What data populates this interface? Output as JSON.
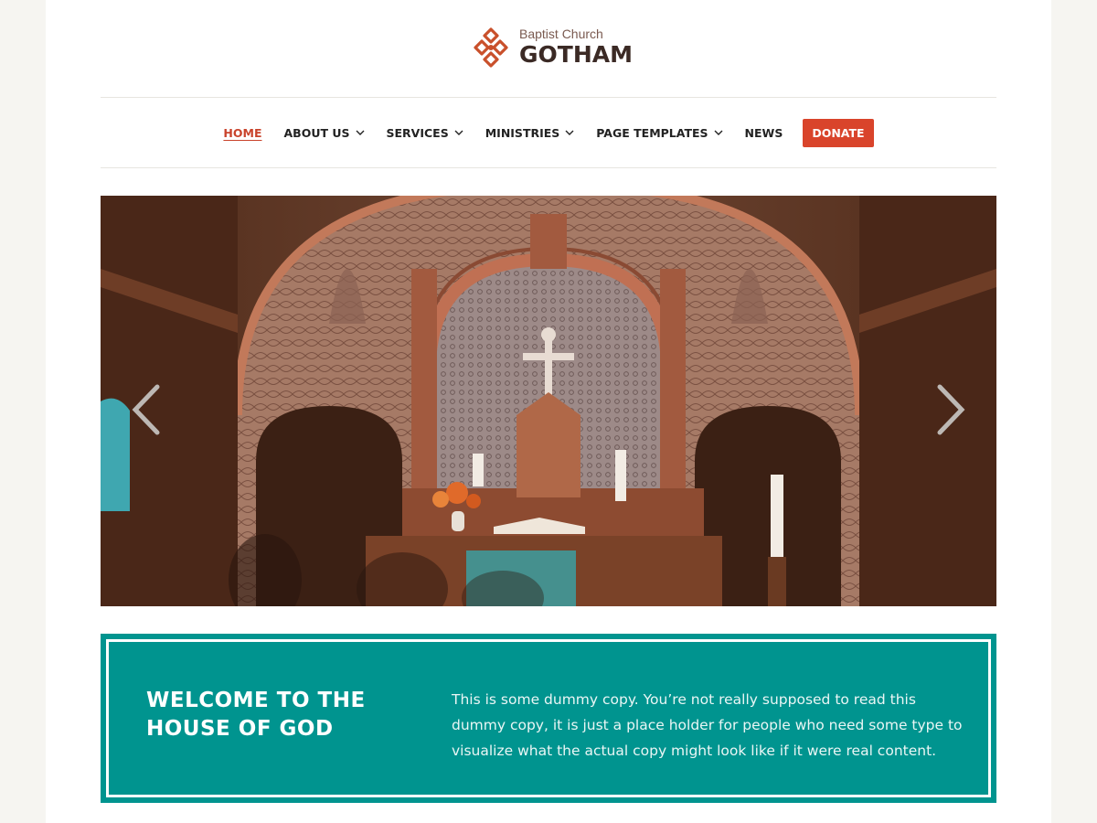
{
  "header": {
    "logo_subtitle": "Baptist Church",
    "logo_title": "GOTHAM"
  },
  "nav": {
    "items": [
      {
        "label": "HOME",
        "active": true,
        "has_dropdown": false
      },
      {
        "label": "ABOUT US",
        "active": false,
        "has_dropdown": true
      },
      {
        "label": "SERVICES",
        "active": false,
        "has_dropdown": true
      },
      {
        "label": "MINISTRIES",
        "active": false,
        "has_dropdown": true
      },
      {
        "label": "PAGE TEMPLATES",
        "active": false,
        "has_dropdown": true
      },
      {
        "label": "NEWS",
        "active": false,
        "has_dropdown": false
      }
    ],
    "donate_label": "DONATE"
  },
  "slider": {
    "prev_icon": "chevron-left-icon",
    "next_icon": "chevron-right-icon"
  },
  "welcome": {
    "title": "WELCOME TO THE HOUSE OF GOD",
    "text": "This is some dummy copy. You’re not really supposed to read this dummy copy, it is just a place holder for people who need some type to visualize what the actual copy might look like if it were real content."
  },
  "colors": {
    "accent": "#d9442b",
    "teal": "#00948f",
    "logo_brown": "#3b2a25",
    "logo_orange": "#c9502b"
  }
}
